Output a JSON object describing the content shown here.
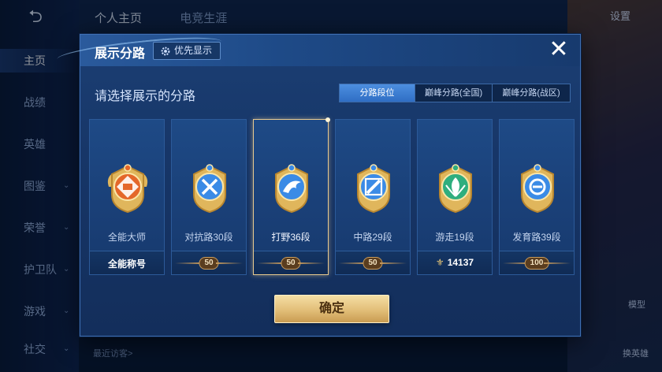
{
  "background": {
    "top_tabs": [
      "个人主页",
      "电竞生涯"
    ],
    "settings_label": "设置",
    "sidebar": [
      {
        "label": "主页",
        "active": true
      },
      {
        "label": "战绩"
      },
      {
        "label": "英雄"
      },
      {
        "label": "图鉴",
        "chevron": true
      },
      {
        "label": "荣誉",
        "chevron": true
      },
      {
        "label": "护卫队",
        "chevron": true
      },
      {
        "label": "游戏",
        "chevron": true
      },
      {
        "label": "社交",
        "chevron": true
      }
    ],
    "recent_visitors": "最近访客>",
    "right_labels": {
      "model": "模型",
      "change_hero": "换英雄"
    }
  },
  "modal": {
    "title": "展示分路",
    "priority_label": "优先显示",
    "close_symbol": "✕",
    "prompt": "请选择展示的分路",
    "tabs": [
      {
        "label": "分路段位",
        "active": true
      },
      {
        "label": "巅峰分路(全国)",
        "active": false
      },
      {
        "label": "巅峰分路(战区)",
        "active": false
      }
    ],
    "cards": [
      {
        "name": "全能大师",
        "footer_type": "text",
        "footer": "全能称号",
        "emblem": "omni-master",
        "color": "#e4672a",
        "selected": false
      },
      {
        "name": "对抗路30段",
        "footer_type": "badge",
        "footer": "50",
        "emblem": "clash-lane",
        "color": "#3b8be6",
        "selected": false
      },
      {
        "name": "打野36段",
        "footer_type": "badge",
        "footer": "50",
        "emblem": "jungle",
        "color": "#3b8be6",
        "selected": true
      },
      {
        "name": "中路29段",
        "footer_type": "badge",
        "footer": "50",
        "emblem": "mid-lane",
        "color": "#3b8be6",
        "selected": false
      },
      {
        "name": "游走19段",
        "footer_type": "points",
        "footer": "14137",
        "emblem": "roam",
        "color": "#2fae7e",
        "selected": false
      },
      {
        "name": "发育路39段",
        "footer_type": "badge",
        "footer": "100",
        "emblem": "farm-lane",
        "color": "#3b8be6",
        "selected": false
      }
    ],
    "confirm_label": "确定"
  }
}
